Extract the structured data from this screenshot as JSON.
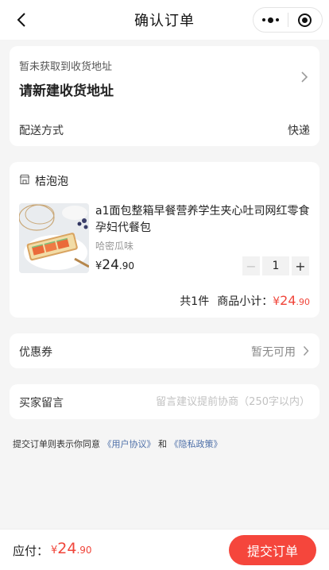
{
  "header": {
    "title": "确认订单",
    "back_icon": "chevron-left-icon",
    "menu_icon": "more-dots-icon",
    "close_icon": "target-circle-icon"
  },
  "address": {
    "hint": "暂未获取到收货地址",
    "main": "请新建收货地址",
    "arrow_icon": "chevron-right-icon"
  },
  "shipping": {
    "label": "配送方式",
    "value": "快递"
  },
  "shop": {
    "icon": "store-icon",
    "name": "桔泡泡",
    "product": {
      "title": "a1面包整箱早餐营养学生夹心吐司网红零食孕妇代餐包",
      "spec": "哈密瓜味",
      "price_currency": "¥",
      "price_int": "24",
      "price_dec": ".90",
      "quantity": "1",
      "minus": "−",
      "plus": "+"
    },
    "summary": {
      "count_text": "共1件",
      "subtotal_label": "商品小计：",
      "subtotal_currency": "¥",
      "subtotal_int": "24",
      "subtotal_dec": ".90"
    }
  },
  "coupon": {
    "label": "优惠券",
    "value": "暂无可用"
  },
  "message": {
    "label": "买家留言",
    "placeholder": "留言建议提前协商（250字以内）",
    "value": ""
  },
  "agreement": {
    "prefix": "提交订单则表示你同意",
    "link1": "《用户协议》",
    "and": "和",
    "link2": "《隐私政策》"
  },
  "footer": {
    "pay_label": "应付：",
    "pay_currency": "¥",
    "pay_int": "24",
    "pay_dec": ".90",
    "submit": "提交订单"
  },
  "colors": {
    "accent": "#f5463c",
    "price_red": "#f0453a",
    "link": "#4d6fa8",
    "background": "#f5f5f5"
  }
}
